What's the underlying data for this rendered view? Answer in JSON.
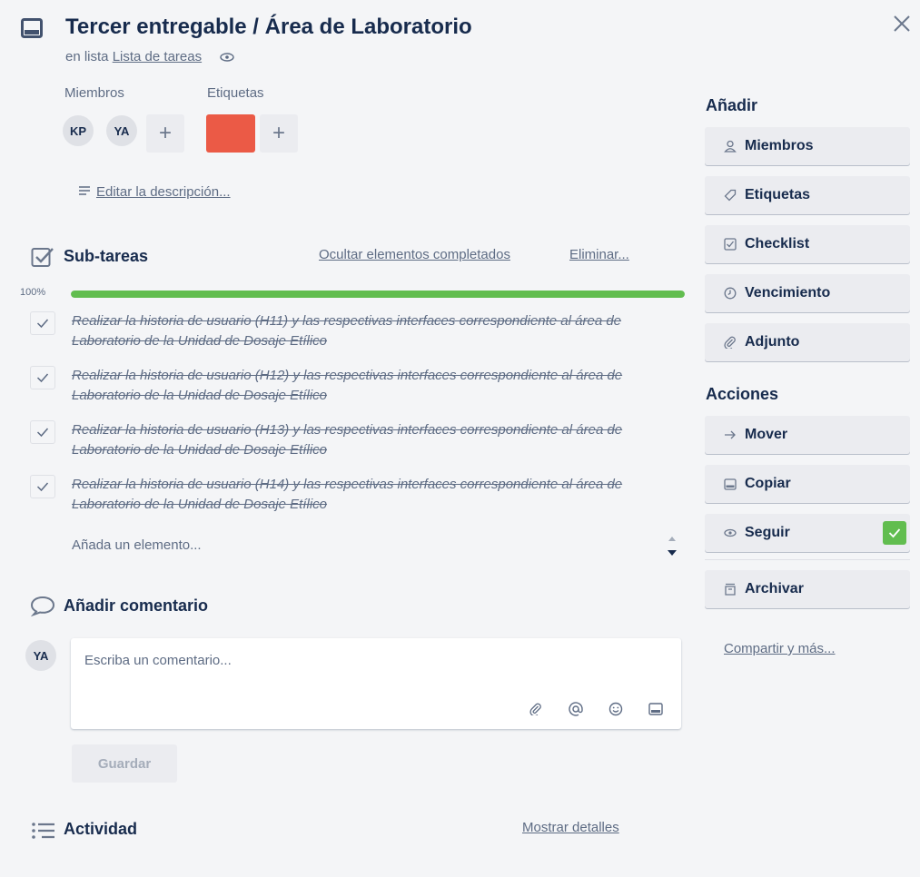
{
  "card": {
    "title": "Tercer entregable / Área de Laboratorio",
    "in_list_prefix": "en lista",
    "list_name": "Lista de tareas"
  },
  "members": {
    "label": "Miembros",
    "avatars": [
      "KP",
      "YA"
    ],
    "add": "+"
  },
  "labels": {
    "label": "Etiquetas",
    "chip_color": "#eb5a46",
    "add": "+"
  },
  "description": {
    "edit_link": "Editar la descripción..."
  },
  "checklist": {
    "title": "Sub-tareas",
    "hide_completed": "Ocultar elementos completados",
    "delete": "Eliminar...",
    "progress_label": "100%",
    "progress": 1.0,
    "items": [
      {
        "text": "Realizar la historia de usuario (H11) y las respectivas interfaces correspondiente al área de Laboratorio de la Unidad de Dosaje Etílico",
        "done": true
      },
      {
        "text": "Realizar la historia de usuario (H12) y las respectivas interfaces correspondiente al área de Laboratorio de la Unidad de Dosaje Etílico",
        "done": true
      },
      {
        "text": "Realizar la historia de usuario (H13) y las respectivas interfaces correspondiente al área de Laboratorio de la Unidad de Dosaje Etílico",
        "done": true
      },
      {
        "text": "Realizar la historia de usuario (H14) y las respectivas interfaces correspondiente al área de Laboratorio de la Unidad de Dosaje Etílico",
        "done": true
      }
    ],
    "add_item": "Añada un elemento..."
  },
  "comment": {
    "title": "Añadir comentario",
    "avatar": "YA",
    "placeholder": "Escriba un comentario...",
    "save": "Guardar"
  },
  "activity": {
    "title": "Actividad",
    "show_details": "Mostrar detalles"
  },
  "sidebar": {
    "add_heading": "Añadir",
    "add_buttons": [
      "Miembros",
      "Etiquetas",
      "Checklist",
      "Vencimiento",
      "Adjunto"
    ],
    "actions_heading": "Acciones",
    "action_buttons": [
      "Mover",
      "Copiar",
      "Seguir",
      "Archivar"
    ],
    "share": "Compartir y más..."
  },
  "colors": {
    "accent_green": "#61bd4f",
    "label_red": "#eb5a46"
  }
}
